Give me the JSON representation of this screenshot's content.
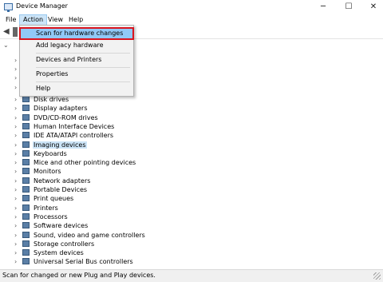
{
  "window": {
    "title": "Device Manager",
    "minimize": "─",
    "maximize": "☐",
    "close": "✕"
  },
  "menubar": [
    "File",
    "Action",
    "View",
    "Help"
  ],
  "action_menu": [
    "Scan for hardware changes",
    "Add legacy hardware",
    "Devices and Printers",
    "Properties",
    "Help"
  ],
  "tree": {
    "categories": [
      "Disk drives",
      "Display adapters",
      "DVD/CD-ROM drives",
      "Human Interface Devices",
      "IDE ATA/ATAPI controllers",
      "Imaging devices",
      "Keyboards",
      "Mice and other pointing devices",
      "Monitors",
      "Network adapters",
      "Portable Devices",
      "Print queues",
      "Printers",
      "Processors",
      "Software devices",
      "Sound, video and game controllers",
      "Storage controllers",
      "System devices",
      "Universal Serial Bus controllers"
    ],
    "selected": "Imaging devices"
  },
  "status": "Scan for changed or new Plug and Play devices."
}
